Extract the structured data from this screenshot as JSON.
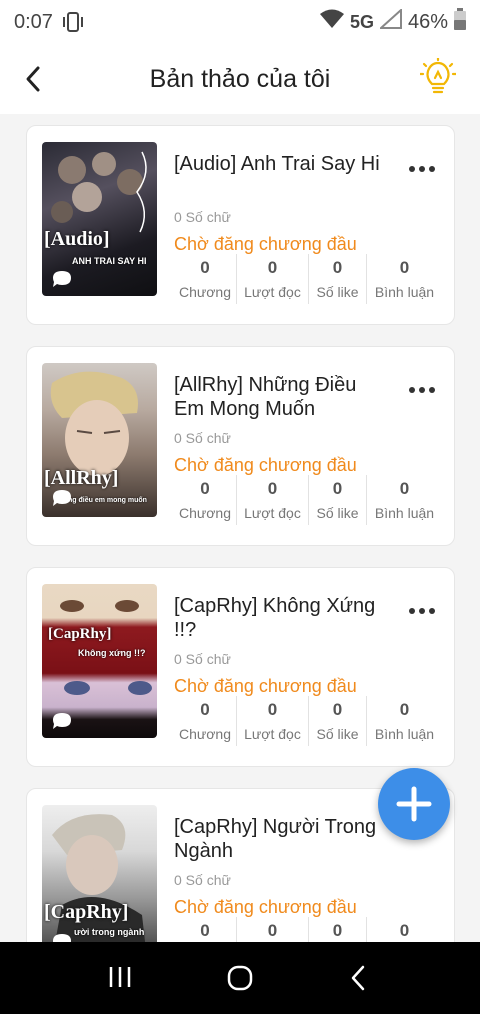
{
  "status_bar": {
    "time": "0:07",
    "network": "5G",
    "battery": "46%"
  },
  "header": {
    "title": "Bản thảo của tôi"
  },
  "stat_labels": {
    "chapters": "Chương",
    "reads": "Lượt đọc",
    "likes": "Số like",
    "comments": "Bình luận"
  },
  "drafts": [
    {
      "title": "[Audio] Anh Trai Say Hi",
      "word_count": "0 Số chữ",
      "status": "Chờ đăng chương đầu",
      "cover_tag": "[Audio]",
      "cover_sub": "ANH TRAI SAY HI",
      "chapters": "0",
      "reads": "0",
      "likes": "0",
      "comments": "0"
    },
    {
      "title": "[AllRhy] Những Điều Em Mong Muốn",
      "word_count": "0 Số chữ",
      "status": "Chờ đăng chương đầu",
      "cover_tag": "[AllRhy]",
      "cover_sub": "ng điều em mong muốn",
      "chapters": "0",
      "reads": "0",
      "likes": "0",
      "comments": "0"
    },
    {
      "title": "[CapRhy] Không Xứng !!?",
      "word_count": "0 Số chữ",
      "status": "Chờ đăng chương đầu",
      "cover_tag": "[CapRhy]",
      "cover_sub": "Không xứng !!?",
      "chapters": "0",
      "reads": "0",
      "likes": "0",
      "comments": "0"
    },
    {
      "title": "[CapRhy] Người Trong Ngành",
      "word_count": "0 Số chữ",
      "status": "Chờ đăng chương đầu",
      "cover_tag": "[CapRhy]",
      "cover_sub": "ười trong ngành",
      "chapters": "0",
      "reads": "0",
      "likes": "0",
      "comments": ""
    }
  ],
  "colors": {
    "accent_orange": "#f08a1c",
    "fab_blue": "#3d8ee8"
  }
}
